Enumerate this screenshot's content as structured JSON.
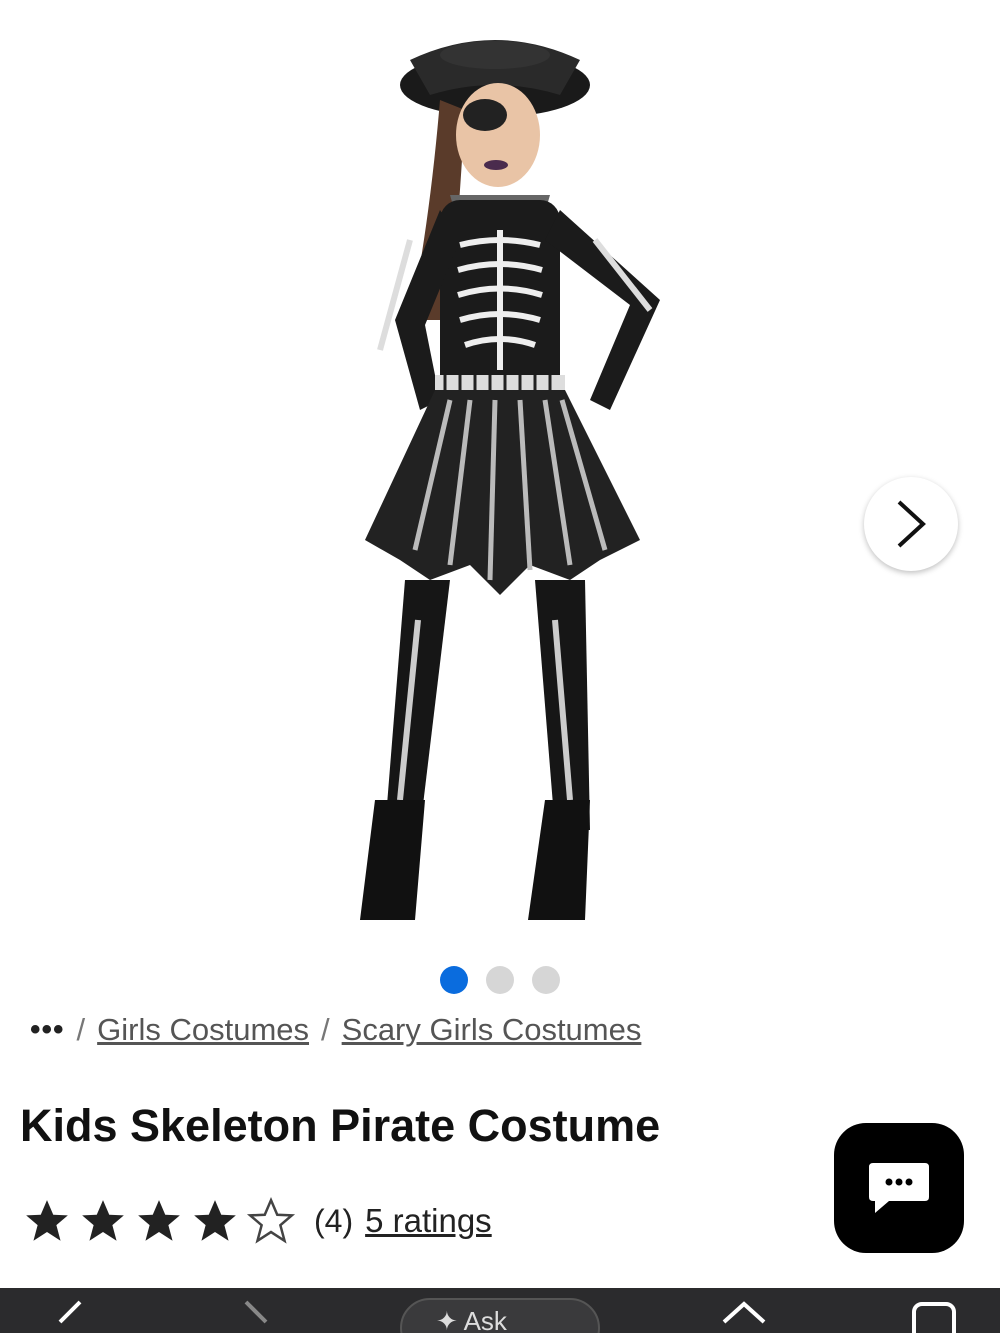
{
  "product": {
    "title": "Kids Skeleton Pirate Costume",
    "image_alt": "Kids Skeleton Pirate Costume product photo"
  },
  "carousel": {
    "total_dots": 3,
    "active_index": 0,
    "accent_color": "#0a6cde"
  },
  "breadcrumb": {
    "more_label": "•••",
    "items": [
      "Girls Costumes",
      "Scary Girls Costumes"
    ]
  },
  "rating": {
    "stars": 4,
    "max_stars": 5,
    "count_label": "(4)",
    "ratings_link": "5 ratings"
  },
  "chat": {
    "icon": "chat-bubble-icon",
    "label": "..."
  },
  "bottom_bar": {
    "ask_label": "Ask",
    "icons": [
      "back-icon",
      "forward-icon",
      "ask-icon",
      "home-icon",
      "tabs-icon"
    ]
  }
}
